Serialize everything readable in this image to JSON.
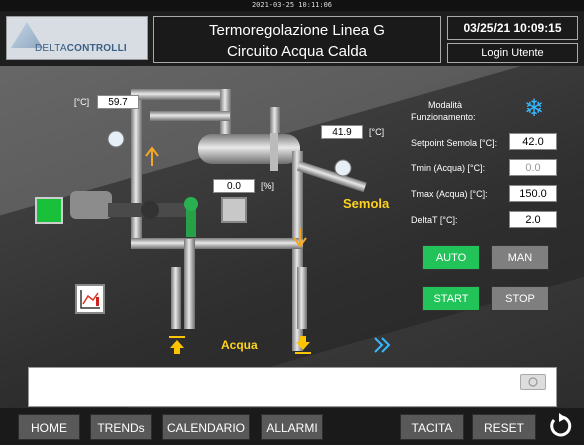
{
  "timestamp_top": "2021-03-25 10:11:06",
  "header": {
    "logo_delta": "DELTA",
    "logo_controlli": "CONTROLLI",
    "title_line1": "Termoregolazione Linea G",
    "title_line2": "Circuito Acqua Calda",
    "datetime": "03/25/21 10:09:15",
    "login": "Login Utente"
  },
  "process": {
    "temp_left": {
      "unit": "[°C]",
      "value": "59.7"
    },
    "temp_right": {
      "unit": "[°C]",
      "value": "41.9"
    },
    "valve_pct": {
      "value": "0.0",
      "unit": "[%]"
    },
    "semola_label": "Semola",
    "acqua_label": "Acqua"
  },
  "params": {
    "mode_label_1": "Modalità",
    "mode_label_2": "Funzionamento:",
    "mode_icon": "snowflake-icon",
    "setpoint_label": "Setpoint Semola [°C]:",
    "setpoint_value": "42.0",
    "tmin_label": "Tmin (Acqua) [°C]:",
    "tmin_value": "0.0",
    "tmax_label": "Tmax (Acqua) [°C]:",
    "tmax_value": "150.0",
    "deltat_label": "DeltaT [°C]:",
    "deltat_value": "2.0"
  },
  "controls": {
    "auto": "AUTO",
    "man": "MAN",
    "start": "START",
    "stop": "STOP"
  },
  "nav": {
    "home": "HOME",
    "trends": "TRENDs",
    "calendar": "CALENDARIO",
    "alarms": "ALLARMI",
    "tacita": "TACITA",
    "reset": "RESET"
  },
  "colors": {
    "accent_green": "#22c45a",
    "label_yellow": "#ffd21f",
    "arrow_orange": "#f5a623",
    "snowflake_blue": "#35b8ff"
  }
}
